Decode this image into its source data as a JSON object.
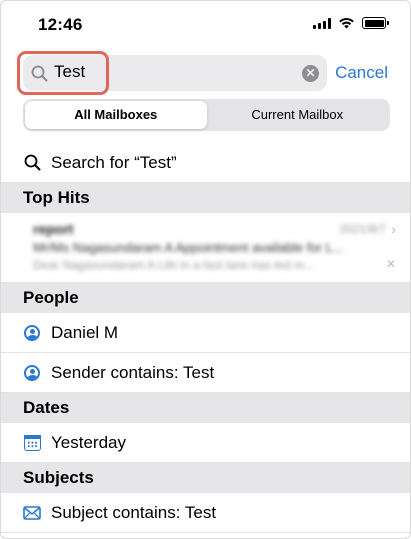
{
  "status_bar": {
    "time": "12:46"
  },
  "search": {
    "query": "Test",
    "cancel_label": "Cancel"
  },
  "segmented": {
    "options": [
      "All Mailboxes",
      "Current Mailbox"
    ],
    "selected": "All Mailboxes"
  },
  "suggestion": {
    "label": "Search for “Test”"
  },
  "sections": {
    "top_hits": "Top Hits",
    "people": "People",
    "dates": "Dates",
    "subjects": "Subjects"
  },
  "top_hit": {
    "sender": "report",
    "date": "2021/8/7",
    "subject": "Mr/Ms Nagasundaram A Appointment available for L...",
    "preview": "Dear Nagasundaram A Life in a fast lane has led m..."
  },
  "people": {
    "items": [
      "Daniel M",
      "Sender contains: Test"
    ]
  },
  "dates": {
    "items": [
      "Yesterday"
    ]
  },
  "subjects": {
    "items": [
      "Subject contains: Test"
    ]
  },
  "colors": {
    "accent": "#2a76d2",
    "highlight": "#e0655a",
    "section_bg": "#e6e6e8"
  }
}
